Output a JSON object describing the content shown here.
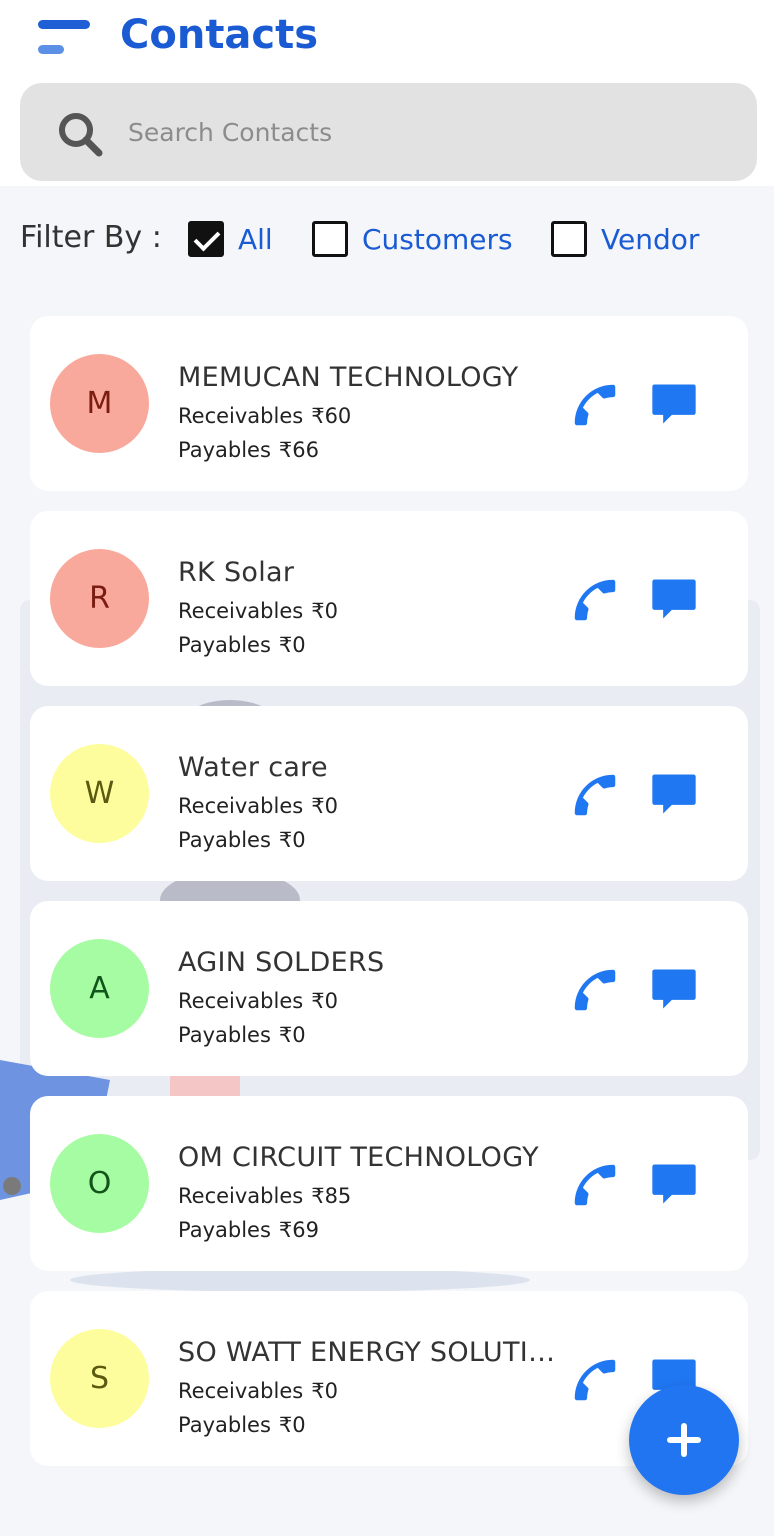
{
  "header": {
    "title": "Contacts"
  },
  "search": {
    "placeholder": "Search Contacts",
    "value": ""
  },
  "filter": {
    "label": "Filter By :",
    "options": [
      {
        "label": "All",
        "checked": true
      },
      {
        "label": "Customers",
        "checked": false
      },
      {
        "label": "Vendor",
        "checked": false
      }
    ]
  },
  "contacts": [
    {
      "initial": "M",
      "name": "MEMUCAN TECHNOLOGY",
      "receivables_label": "Receivables",
      "receivables": "₹60",
      "payables_label": "Payables",
      "payables": "₹66",
      "avatar_bg": "#f9a99b",
      "avatar_fg": "#7a1c10"
    },
    {
      "initial": "R",
      "name": "RK Solar",
      "receivables_label": "Receivables",
      "receivables": "₹0",
      "payables_label": "Payables",
      "payables": "₹0",
      "avatar_bg": "#f9a99b",
      "avatar_fg": "#7a1c10"
    },
    {
      "initial": "W",
      "name": "Water care",
      "receivables_label": "Receivables",
      "receivables": "₹0",
      "payables_label": "Payables",
      "payables": "₹0",
      "avatar_bg": "#fdfd9e",
      "avatar_fg": "#5a5a10"
    },
    {
      "initial": "A",
      "name": "AGIN SOLDERS",
      "receivables_label": "Receivables",
      "receivables": "₹0",
      "payables_label": "Payables",
      "payables": "₹0",
      "avatar_bg": "#a6fca2",
      "avatar_fg": "#12551a"
    },
    {
      "initial": "O",
      "name": "OM CIRCUIT TECHNOLOGY",
      "receivables_label": "Receivables",
      "receivables": "₹85",
      "payables_label": "Payables",
      "payables": "₹69",
      "avatar_bg": "#a6fca2",
      "avatar_fg": "#12551a"
    },
    {
      "initial": "S",
      "name": "SO WATT ENERGY SOLUTIONS",
      "receivables_label": "Receivables",
      "receivables": "₹0",
      "payables_label": "Payables",
      "payables": "₹0",
      "avatar_bg": "#fdfd9e",
      "avatar_fg": "#5a5a10"
    }
  ],
  "colors": {
    "accent": "#1a5bd4",
    "icon_blue": "#1f77f2",
    "fab": "#2275f0"
  },
  "icons": {
    "menu": "menu-icon",
    "search": "search-icon",
    "phone": "phone-icon",
    "message": "message-icon",
    "add": "plus-icon"
  }
}
